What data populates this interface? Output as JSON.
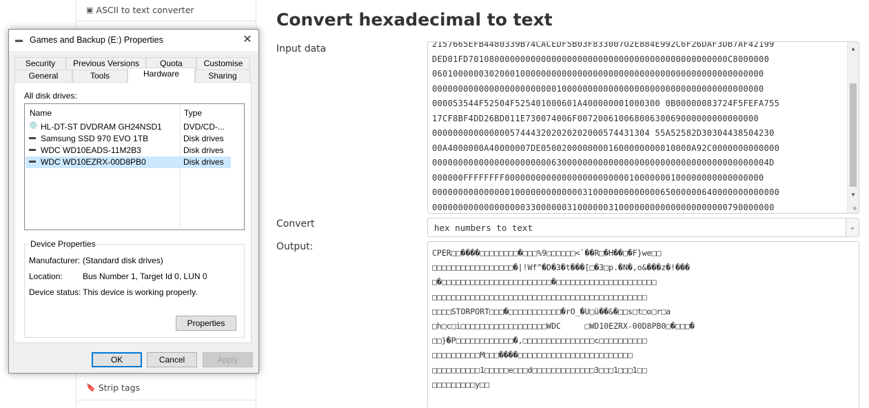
{
  "sidebar": {
    "top_item": {
      "label": "ASCII to text converter",
      "icon": "ascii-icon"
    },
    "bottom_item": {
      "label": "Strip tags",
      "icon": "tag-icon"
    }
  },
  "page": {
    "title": "Convert hexadecimal to text",
    "input_label": "Input data",
    "convert_label": "Convert",
    "output_label": "Output:"
  },
  "input": {
    "text": "2157665EFB4480339B74CACEDF5B03F833007O2E884E992C6F26DAF3DB7AF42199\nDED01FD70108000000000000000000000000000000000000000000000C8000000\n0601000000302000100000000000000000000000000000000000000000000000\n0000000000000000000000001000000000000000000000000000000000000000\n000053544F52504F525401000601A400000001000300 0B00000083724F5FEFA755\n17CF8BF4DD26BD011E730074006F00720061006800630069000000000000000\n000000000000000574443202020202000574431304 55A52582D30304438504230\n00A4000000A40000007DE05002000000001600000000010000A92C0000000000000\n00000000000000000000000630000000000000000000000000000000000000004D\n000000FFFFFFFF00000000000000000000000010000000100000000000000000\n0000000000000001000000000000031000000000000065000000640000000000000\n000000000000000000330000003100000031000000000000000000000790000000"
  },
  "convert": {
    "selected": "hex numbers to text"
  },
  "output": {
    "text": "CPER□□����□□□□□□□□�□□□%9□□□□□□<`��R□�H��□�F}we□□\n□□□□□□□□□□□□□□□□□�|!Wf^�D�3�t���[□�3□p.�N�,o&���z�!���\n□�□□□□□□□□□□□□□□□□□□□□□□□�□□□□□□□□□□□□□□□□□□□□□\n□□□□□□□□□□□□□□□□□□□□□□□□□□□□□□□□□□□□□□□□□□□□□\n□□□□STORPORT□□□�□□□□□□□□□□□�rO_�U□ü��&�□□s□t□o□r□a\n□h□c□i□□□□□□□□□□□□□□□□□□WDC     □WD10EZRX-00D8PB0□�□□□�\n□□}�P□□□□□□□□□□□□�,□□□□□□□□□□□□□□□c□□□□□□□□□□\n□□□□□□□□□□M□□□����□□□□□□□□□□□□□□□□□□□□□□□□\n□□□□□□□□□□1□□□□□e□□□d□□□□□□□□□□□□□3□□□1□□□1□□\n□□□□□□□□□y□□"
  },
  "dialog": {
    "title": "Games and Backup (E:) Properties",
    "tabs_row1": [
      "Security",
      "Previous Versions",
      "Quota",
      "Customise"
    ],
    "tabs_row2": [
      "General",
      "Tools",
      "Hardware",
      "Sharing"
    ],
    "active_tab": "Hardware",
    "all_disk_drives_label": "All disk drives:",
    "columns": {
      "name": "Name",
      "type": "Type"
    },
    "drives": [
      {
        "name": "HL-DT-ST DVDRAM GH24NSD1",
        "type": "DVD/CD-...",
        "icon": "optical-drive-icon"
      },
      {
        "name": "Samsung SSD 970 EVO 1TB",
        "type": "Disk drives",
        "icon": "disk-drive-icon"
      },
      {
        "name": "WDC WD10EADS-11M2B3",
        "type": "Disk drives",
        "icon": "disk-drive-icon"
      },
      {
        "name": "WDC WD10EZRX-00D8PB0",
        "type": "Disk drives",
        "icon": "disk-drive-icon"
      }
    ],
    "selected_drive_index": 3,
    "device_properties": {
      "title": "Device Properties",
      "manufacturer_label": "Manufacturer:",
      "manufacturer": "(Standard disk drives)",
      "location_label": "Location:",
      "location": "Bus Number 1, Target Id 0, LUN 0",
      "status_label": "Device status:",
      "status": "This device is working properly.",
      "properties_button": "Properties"
    },
    "buttons": {
      "ok": "OK",
      "cancel": "Cancel",
      "apply": "Apply"
    }
  }
}
